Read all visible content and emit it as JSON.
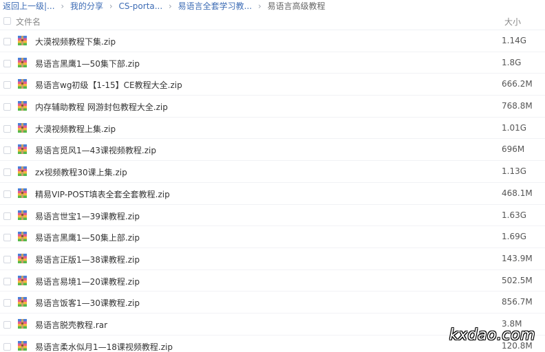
{
  "breadcrumb": {
    "back_label": "返回上一级",
    "more_label": "|...",
    "items": [
      "我的分享",
      "CS-porta...",
      "易语言全套学习教..."
    ],
    "current": "易语言高级教程",
    "separator": "›"
  },
  "table": {
    "col_name": "文件名",
    "col_size": "大小",
    "icon": "archive-file-icon",
    "rows": [
      {
        "name": "大漠视频教程下集.zip",
        "size": "1.14G"
      },
      {
        "name": "易语言黑鹰1—50集下部.zip",
        "size": "1.8G"
      },
      {
        "name": "易语言wg初级【1-15】CE教程大全.zip",
        "size": "666.2M"
      },
      {
        "name": "内存辅助教程 网游封包教程大全.zip",
        "size": "768.8M"
      },
      {
        "name": "大漠视频教程上集.zip",
        "size": "1.01G"
      },
      {
        "name": "易语言觅风1—43课视频教程.zip",
        "size": "696M"
      },
      {
        "name": "zx视频教程30课上集.zip",
        "size": "1.13G"
      },
      {
        "name": "精易VIP-POST填表全套全套教程.zip",
        "size": "468.1M"
      },
      {
        "name": "易语言世宝1—39课教程.zip",
        "size": "1.63G"
      },
      {
        "name": "易语言黑鹰1—50集上部.zip",
        "size": "1.69G"
      },
      {
        "name": "易语言正版1—38课教程.zip",
        "size": "143.9M"
      },
      {
        "name": "易语言易境1—20课教程.zip",
        "size": "502.5M"
      },
      {
        "name": "易语言饭客1—30课教程.zip",
        "size": "856.7M"
      },
      {
        "name": "易语言脱壳教程.rar",
        "size": "3.8M"
      },
      {
        "name": "易语言柔水似月1—18课视频教程.zip",
        "size": "120.8M"
      }
    ]
  },
  "watermark": "kxdao.com",
  "colors": {
    "link": "#3d6cb5",
    "text": "#333333",
    "row_border": "#f1f2f5"
  }
}
